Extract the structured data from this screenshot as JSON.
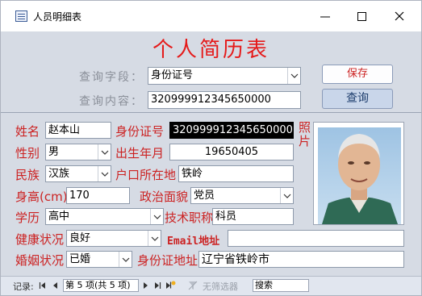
{
  "window": {
    "title": "人员明细表"
  },
  "form": {
    "title": "个人简历表"
  },
  "query": {
    "field_label": "查询字段：",
    "field_value": "身份证号",
    "content_label": "查询内容：",
    "content_value": "320999912345650000",
    "save_label": "保存",
    "search_label": "查询"
  },
  "record": {
    "name_label": "姓名",
    "name": "赵本山",
    "id_label": "身份证号",
    "id": "320999912345650000",
    "photo_label": "照片",
    "gender_label": "性别",
    "gender": "男",
    "birth_label": "出生年月",
    "birth": "19650405",
    "ethnic_label": "民族",
    "ethnic": "汉族",
    "hukou_label": "户口所在地",
    "hukou": "铁岭",
    "height_label": "身高(cm)",
    "height": "170",
    "political_label": "政治面貌",
    "political": "党员",
    "edu_label": "学历",
    "edu": "高中",
    "title_label": "技术职称",
    "title": "科员",
    "health_label": "健康状况",
    "health": "良好",
    "email_label": "Email地址",
    "email": "",
    "marital_label": "婚姻状况",
    "marital": "已婚",
    "idaddr_label": "身份证地址",
    "idaddr": "辽宁省铁岭市"
  },
  "navigator": {
    "record_label": "记录:",
    "position": "第 5 项(共 5 项)",
    "filter_label": "无筛选器",
    "search_label": "搜索"
  },
  "colors": {
    "label_red": "#cc2222",
    "title_red": "#e51a1a",
    "panel": "#d6dbe4"
  }
}
